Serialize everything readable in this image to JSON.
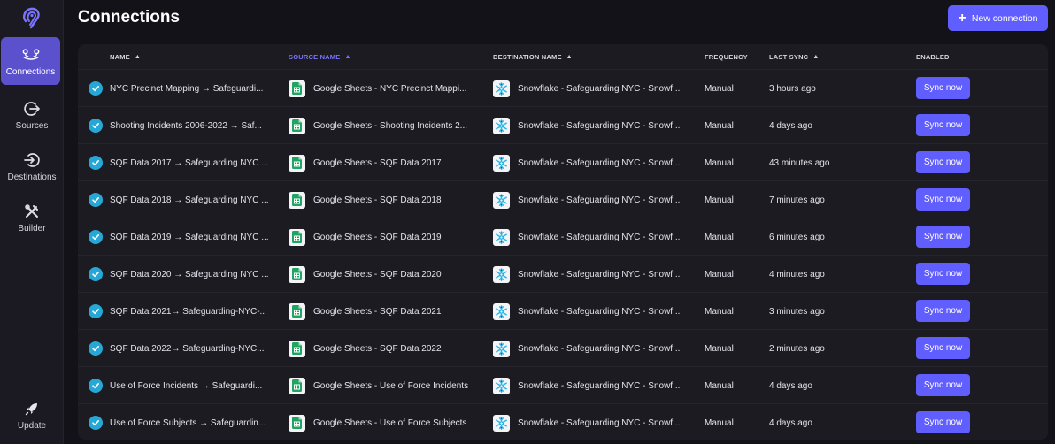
{
  "app": {
    "page_title": "Connections",
    "new_connection_label": "New connection",
    "accent_color": "#615eff",
    "active_nav_color": "#5b51cc"
  },
  "sidebar": {
    "items": [
      {
        "label": "Connections",
        "icon": "connections-icon"
      },
      {
        "label": "Sources",
        "icon": "sources-icon"
      },
      {
        "label": "Destinations",
        "icon": "destinations-icon"
      },
      {
        "label": "Builder",
        "icon": "builder-icon"
      },
      {
        "label": "Update",
        "icon": "rocket-icon"
      }
    ]
  },
  "table": {
    "headers": {
      "name": "NAME",
      "source": "SOURCE NAME",
      "destination": "DESTINATION NAME",
      "frequency": "FREQUENCY",
      "last_sync": "LAST SYNC",
      "enabled": "ENABLED"
    },
    "sort_arrow": "▲",
    "rows": [
      {
        "name": "NYC Precinct Mapping → Safeguardi...",
        "source": "Google Sheets - NYC Precinct Mappi...",
        "destination": "Snowflake - Safeguarding NYC - Snowf...",
        "frequency": "Manual",
        "last_sync": "3 hours ago",
        "action": "Sync now"
      },
      {
        "name": "Shooting Incidents 2006-2022 → Saf...",
        "source": "Google Sheets - Shooting Incidents 2...",
        "destination": "Snowflake - Safeguarding NYC - Snowf...",
        "frequency": "Manual",
        "last_sync": "4 days ago",
        "action": "Sync now"
      },
      {
        "name": "SQF Data 2017 → Safeguarding NYC ...",
        "source": "Google Sheets - SQF Data 2017",
        "destination": "Snowflake - Safeguarding NYC - Snowf...",
        "frequency": "Manual",
        "last_sync": "43 minutes ago",
        "action": "Sync now"
      },
      {
        "name": "SQF Data 2018 → Safeguarding NYC ...",
        "source": "Google Sheets - SQF Data 2018",
        "destination": "Snowflake - Safeguarding NYC - Snowf...",
        "frequency": "Manual",
        "last_sync": "7 minutes ago",
        "action": "Sync now"
      },
      {
        "name": "SQF Data 2019 → Safeguarding NYC ...",
        "source": "Google Sheets - SQF Data 2019",
        "destination": "Snowflake - Safeguarding NYC - Snowf...",
        "frequency": "Manual",
        "last_sync": "6 minutes ago",
        "action": "Sync now"
      },
      {
        "name": "SQF Data 2020 → Safeguarding NYC ...",
        "source": "Google Sheets - SQF Data 2020",
        "destination": "Snowflake - Safeguarding NYC - Snowf...",
        "frequency": "Manual",
        "last_sync": "4 minutes ago",
        "action": "Sync now"
      },
      {
        "name": "SQF Data 2021→ Safeguarding-NYC-...",
        "source": "Google Sheets - SQF Data 2021",
        "destination": "Snowflake - Safeguarding NYC - Snowf...",
        "frequency": "Manual",
        "last_sync": "3 minutes ago",
        "action": "Sync now"
      },
      {
        "name": "SQF Data 2022→ Safeguarding-NYC...",
        "source": "Google Sheets - SQF Data 2022",
        "destination": "Snowflake - Safeguarding NYC - Snowf...",
        "frequency": "Manual",
        "last_sync": "2 minutes ago",
        "action": "Sync now"
      },
      {
        "name": "Use of Force Incidents → Safeguardi...",
        "source": "Google Sheets - Use of Force Incidents",
        "destination": "Snowflake - Safeguarding NYC - Snowf...",
        "frequency": "Manual",
        "last_sync": "4 days ago",
        "action": "Sync now"
      },
      {
        "name": "Use of Force Subjects → Safeguardin...",
        "source": "Google Sheets - Use of Force Subjects",
        "destination": "Snowflake - Safeguarding NYC - Snowf...",
        "frequency": "Manual",
        "last_sync": "4 days ago",
        "action": "Sync now"
      }
    ]
  }
}
